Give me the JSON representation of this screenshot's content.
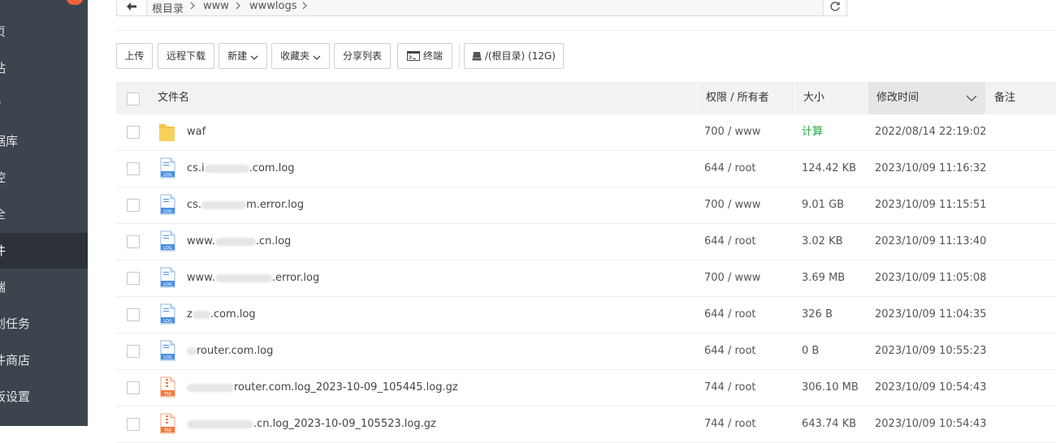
{
  "sidebar": {
    "items": [
      {
        "label": "页",
        "active": false
      },
      {
        "label": "站",
        "active": false
      },
      {
        "label": "P",
        "active": false
      },
      {
        "label": "据库",
        "active": false
      },
      {
        "label": "控",
        "active": false
      },
      {
        "label": "全",
        "active": false
      },
      {
        "label": "件",
        "active": true
      },
      {
        "label": "端",
        "active": false
      },
      {
        "label": "划任务",
        "active": false
      },
      {
        "label": "件商店",
        "active": false
      },
      {
        "label": "板设置",
        "active": false
      }
    ]
  },
  "path": {
    "crumbs": [
      "根目录",
      "www",
      "wwwlogs"
    ]
  },
  "toolbar": {
    "upload": "上传",
    "remote_download": "远程下载",
    "new": "新建",
    "favorites": "收藏夹",
    "share_list": "分享列表",
    "terminal": "终端",
    "disk": "/(根目录) (12G)"
  },
  "table": {
    "headers": {
      "name": "文件名",
      "perm": "权限 / 所有者",
      "size": "大小",
      "mtime": "修改时间",
      "note": "备注"
    },
    "rows": [
      {
        "type": "folder",
        "name_pre": "waf",
        "name_post": "",
        "perm": "700 / www",
        "size": "计算",
        "mtime": "2022/08/14 22:19:02"
      },
      {
        "type": "log",
        "name_pre": "cs.i",
        "name_post": ".com.log",
        "perm": "644 / root",
        "size": "124.42 KB",
        "mtime": "2023/10/09 11:16:32"
      },
      {
        "type": "log",
        "name_pre": "cs.",
        "name_post": "m.error.log",
        "perm": "700 / www",
        "size": "9.01 GB",
        "mtime": "2023/10/09 11:15:51"
      },
      {
        "type": "log",
        "name_pre": "www.",
        "name_post": ".cn.log",
        "perm": "644 / root",
        "size": "3.02 KB",
        "mtime": "2023/10/09 11:13:40"
      },
      {
        "type": "log",
        "name_pre": "www.",
        "name_post": ".error.log",
        "perm": "700 / www",
        "size": "3.69 MB",
        "mtime": "2023/10/09 11:05:08"
      },
      {
        "type": "log",
        "name_pre": "z",
        "name_post": ".com.log",
        "perm": "644 / root",
        "size": "326 B",
        "mtime": "2023/10/09 11:04:35"
      },
      {
        "type": "log",
        "name_pre": "",
        "name_post": "router.com.log",
        "perm": "644 / root",
        "size": "0 B",
        "mtime": "2023/10/09 10:55:23"
      },
      {
        "type": "tar",
        "name_pre": "",
        "name_post": "router.com.log_2023-10-09_105445.log.gz",
        "perm": "744 / root",
        "size": "306.10 MB",
        "mtime": "2023/10/09 10:54:43"
      },
      {
        "type": "tar",
        "name_pre": "",
        "name_post": ".cn.log_2023-10-09_105523.log.gz",
        "perm": "744 / root",
        "size": "643.74 KB",
        "mtime": "2023/10/09 10:54:43"
      }
    ]
  },
  "colors": {
    "sidebar_bg": "#3c444d",
    "accent_green": "#20a53a",
    "folder": "#f5c342",
    "log_icon": "#4a8fe0",
    "tar_icon": "#f07a3c"
  }
}
